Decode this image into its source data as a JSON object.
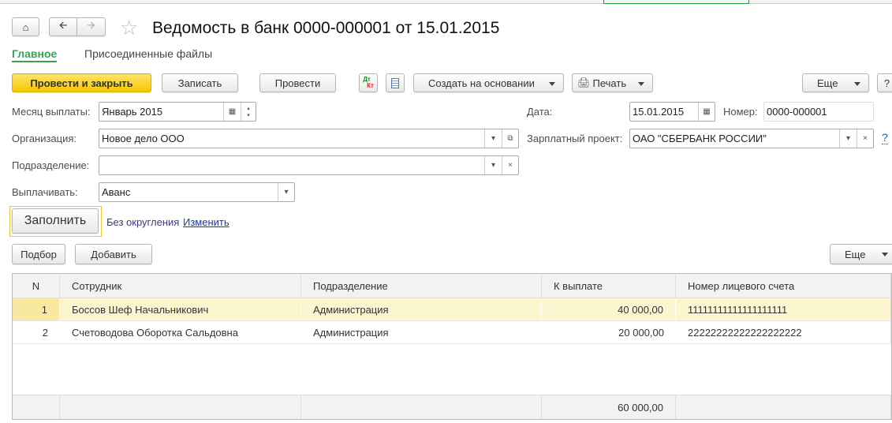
{
  "header": {
    "title": "Ведомость в банк 0000-000001 от 15.01.2015"
  },
  "tabs": [
    {
      "label": "Главное"
    },
    {
      "label": "Присоединенные файлы"
    }
  ],
  "toolbar": {
    "post_close": "Провести и закрыть",
    "save": "Записать",
    "post": "Провести",
    "dtkt_dt": "Дт",
    "dtkt_kt": "Кт",
    "create_based": "Создать на основании",
    "print": "Печать",
    "more": "Еще",
    "help": "?"
  },
  "form": {
    "month_label": "Месяц выплаты:",
    "month_value": "Январь 2015",
    "date_label": "Дата:",
    "date_value": "15.01.2015",
    "number_label": "Номер:",
    "number_value": "0000-000001",
    "org_label": "Организация:",
    "org_value": "Новое дело ООО",
    "project_label": "Зарплатный проект:",
    "project_value": "ОАО \"СБЕРБАНК РОССИИ\"",
    "project_help": "?",
    "dept_label": "Подразделение:",
    "dept_value": "",
    "pay_label": "Выплачивать:",
    "pay_value": "Аванс",
    "fill": "Заполнить",
    "rounding": "Без округления",
    "change": "Изменить"
  },
  "table_toolbar": {
    "pick": "Подбор",
    "add": "Добавить",
    "more": "Еще"
  },
  "table": {
    "columns": [
      "N",
      "Сотрудник",
      "Подразделение",
      "К выплате",
      "Номер лицевого счета"
    ],
    "rows": [
      [
        "1",
        "Боссов Шеф Начальникович",
        "Администрация",
        "40 000,00",
        "11111111111111111111"
      ],
      [
        "2",
        "Счетоводова Оборотка Сальдовна",
        "Администрация",
        "20 000,00",
        "22222222222222222222"
      ]
    ],
    "total": "60 000,00"
  }
}
